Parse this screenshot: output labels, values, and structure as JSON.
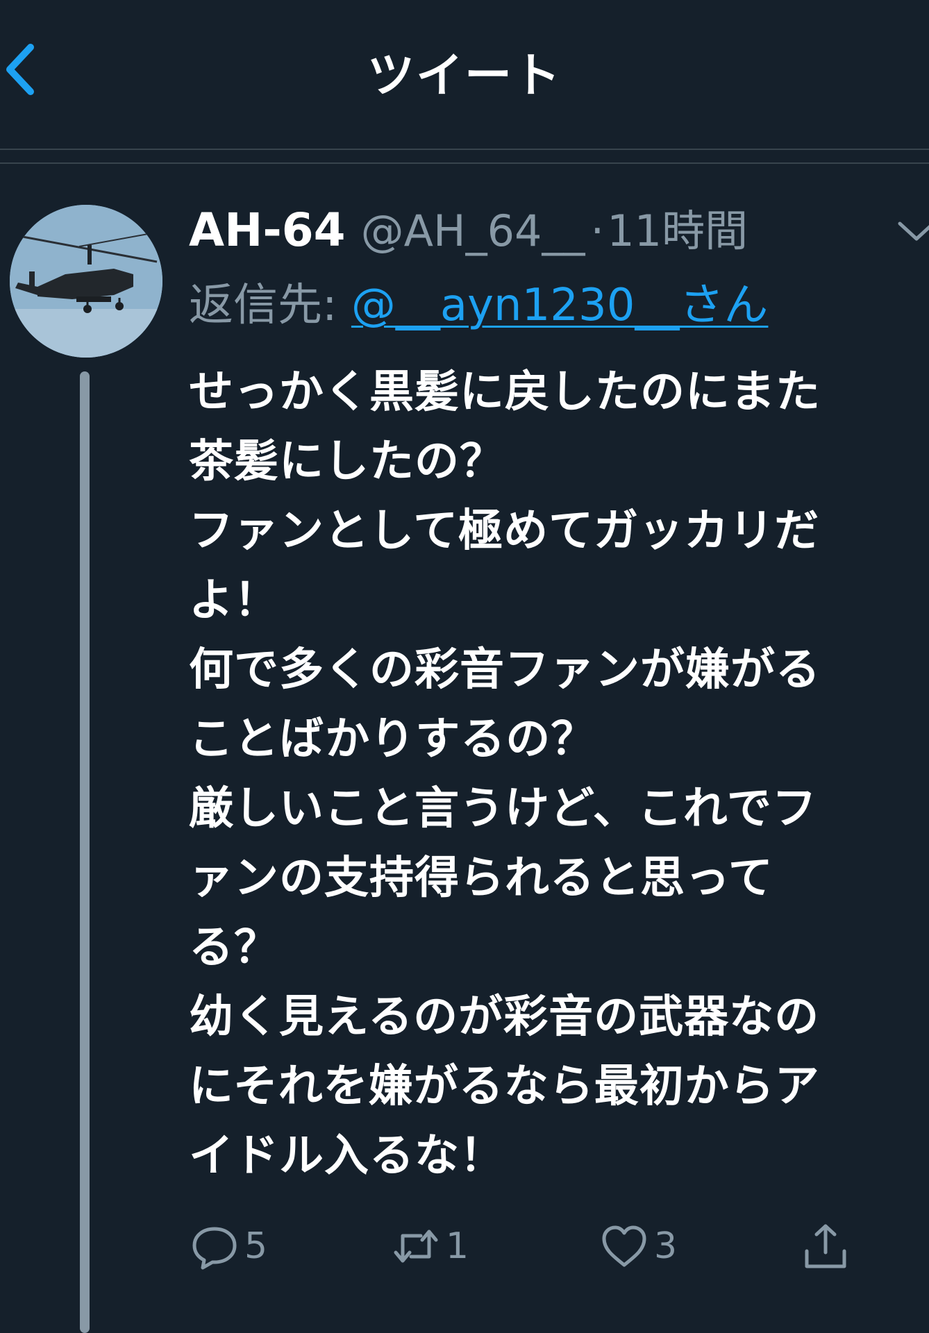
{
  "header": {
    "title": "ツイート",
    "back_icon": "chevron-left-icon"
  },
  "tweet": {
    "display_name": "AH-64",
    "handle": "@AH_64__",
    "separator": "·",
    "time": "11時間",
    "reply_prefix": "返信先: ",
    "reply_user": "@__ayn1230__さん",
    "avatar": "helicopter-avatar",
    "body_lines": [
      "せっかく黒髪に戻したのにまた",
      "茶髪にしたの？",
      "ファンとして極めてガッカリだ",
      "よ！",
      "何で多くの彩音ファンが嫌がる",
      "ことばかりするの？",
      "厳しいこと言うけど、これでフ",
      "ァンの支持得られると思って",
      "る？",
      "幼く見えるのが彩音の武器なの",
      "にそれを嫌がるなら最初からア",
      "イドル入るな！"
    ]
  },
  "actions": {
    "reply_count": "5",
    "retweet_count": "1",
    "like_count": "3"
  },
  "colors": {
    "background": "#15202b",
    "accent": "#1da1f2",
    "secondary_text": "#8899a6",
    "divider": "#38444d"
  }
}
